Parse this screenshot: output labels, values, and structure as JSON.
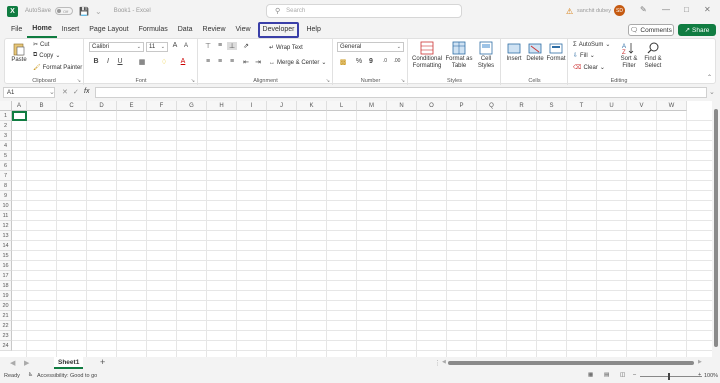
{
  "titlebar": {
    "autosave_label": "AutoSave",
    "autosave_state": "Off",
    "doc_title": "Book1 - Excel",
    "search_placeholder": "Search",
    "user_name": "sanchit dubey",
    "user_initials": "SD"
  },
  "tabs": [
    "File",
    "Home",
    "Insert",
    "Page Layout",
    "Formulas",
    "Data",
    "Review",
    "View",
    "Developer",
    "Help"
  ],
  "active_tab": "Home",
  "highlighted_tab": "Developer",
  "buttons": {
    "comments": "Comments",
    "share": "Share"
  },
  "ribbon": {
    "clipboard": {
      "label": "Clipboard",
      "paste": "Paste",
      "cut": "Cut",
      "copy": "Copy",
      "format_painter": "Format Painter"
    },
    "font": {
      "label": "Font",
      "name": "Calibri",
      "size": "11"
    },
    "alignment": {
      "label": "Alignment",
      "wrap_text": "Wrap Text",
      "merge_center": "Merge & Center"
    },
    "number": {
      "label": "Number",
      "format": "General"
    },
    "styles": {
      "label": "Styles",
      "conditional_1": "Conditional",
      "conditional_2": "Formatting",
      "format_table_1": "Format as",
      "format_table_2": "Table",
      "cell_styles_1": "Cell",
      "cell_styles_2": "Styles"
    },
    "cells": {
      "label": "Cells",
      "insert": "Insert",
      "delete": "Delete",
      "format": "Format"
    },
    "editing": {
      "label": "Editing",
      "autosum": "AutoSum",
      "fill": "Fill",
      "clear": "Clear",
      "sort_1": "Sort &",
      "sort_2": "Filter",
      "find_1": "Find &",
      "find_2": "Select"
    }
  },
  "formula_bar": {
    "name_box": "A1",
    "formula": ""
  },
  "columns": [
    "A",
    "B",
    "C",
    "D",
    "E",
    "F",
    "G",
    "H",
    "I",
    "J",
    "K",
    "L",
    "M",
    "N",
    "O",
    "P",
    "Q",
    "R",
    "S",
    "T",
    "U",
    "V",
    "W"
  ],
  "rows": [
    "1",
    "2",
    "3",
    "4",
    "5",
    "6",
    "7",
    "8",
    "9",
    "10",
    "11",
    "12",
    "13",
    "14",
    "15",
    "16",
    "17",
    "18",
    "19",
    "20",
    "21",
    "22",
    "23",
    "24"
  ],
  "sheets": [
    "Sheet1"
  ],
  "status": {
    "ready": "Ready",
    "accessibility": "Accessibility: Good to go",
    "zoom": "100%"
  },
  "colors": {
    "accent": "#107c41",
    "highlight_border": "#3a3fa8"
  }
}
